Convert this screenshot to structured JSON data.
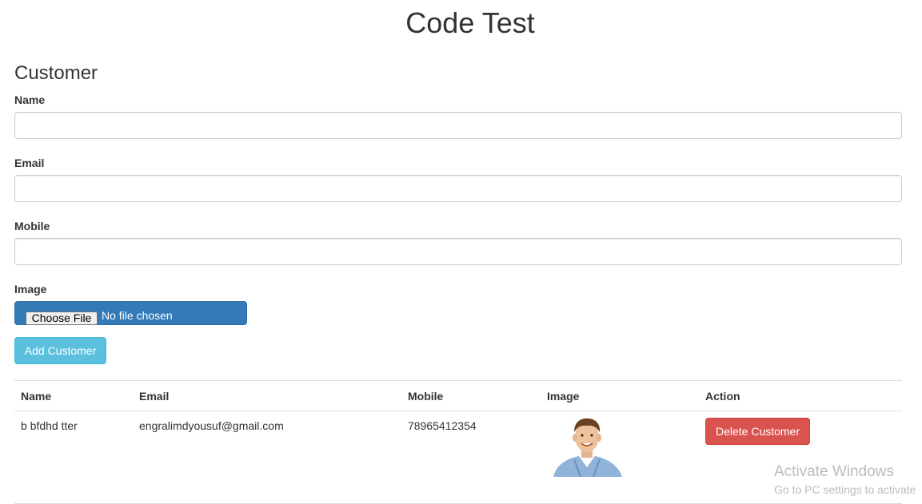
{
  "page": {
    "title": "Code Test"
  },
  "form": {
    "section_title": "Customer",
    "name_label": "Name",
    "name_value": "",
    "email_label": "Email",
    "email_value": "",
    "mobile_label": "Mobile",
    "mobile_value": "",
    "image_label": "Image",
    "file_button_label": "Choose File",
    "file_status": "No file chosen",
    "submit_label": "Add Customer"
  },
  "table": {
    "headers": [
      "Name",
      "Email",
      "Mobile",
      "Image",
      "Action"
    ],
    "rows": [
      {
        "name": "b bfdhd tter",
        "email": "engralimdyousuf@gmail.com",
        "mobile": "78965412354",
        "image": "customer-photo",
        "action_label": "Delete Customer"
      }
    ]
  },
  "watermark": {
    "title": "Activate Windows",
    "subtitle": "Go to PC settings to activate"
  },
  "colors": {
    "primary": "#337ab7",
    "info": "#5bc0de",
    "danger": "#d9534f",
    "border": "#dddddd"
  }
}
